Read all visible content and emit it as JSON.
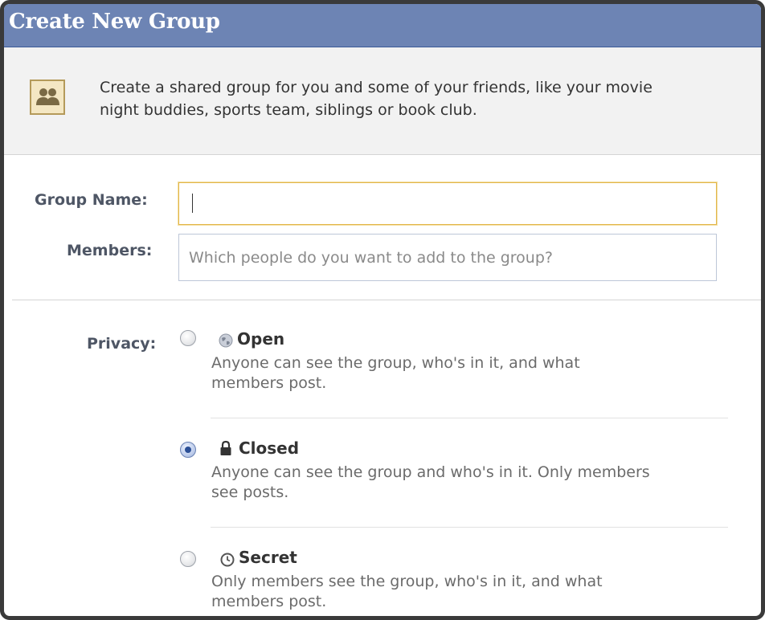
{
  "dialog": {
    "title": "Create New Group"
  },
  "intro": {
    "icon": "group-icon",
    "text_line1": "Create a shared group for you and some of your friends, like your movie",
    "text_line2": "night buddies, sports team, siblings or book club."
  },
  "form": {
    "group_name": {
      "label": "Group Name:",
      "value": "",
      "placeholder": "",
      "focused": true
    },
    "members": {
      "label": "Members:",
      "value": "",
      "placeholder": "Which people do you want to add to the group?"
    }
  },
  "privacy": {
    "label": "Privacy:",
    "selected": "Closed",
    "options": [
      {
        "title": "Open",
        "icon": "globe-icon",
        "desc_line1": "Anyone can see the group, who's in it, and what",
        "desc_line2": "members post."
      },
      {
        "title": "Closed",
        "icon": "lock-icon",
        "desc_line1": "Anyone can see the group and who's in it. Only members",
        "desc_line2": "see posts."
      },
      {
        "title": "Secret",
        "icon": "clock-icon",
        "desc_line1": "Only members see the group, who's in it, and what",
        "desc_line2": "members post."
      }
    ]
  },
  "colors": {
    "header": "#6d84b4",
    "header_border": "#3b5998",
    "focus_border": "#e2b64a",
    "label_text": "#4e5665",
    "description_text": "#6b6b6b",
    "intro_background": "#f2f2f2"
  }
}
